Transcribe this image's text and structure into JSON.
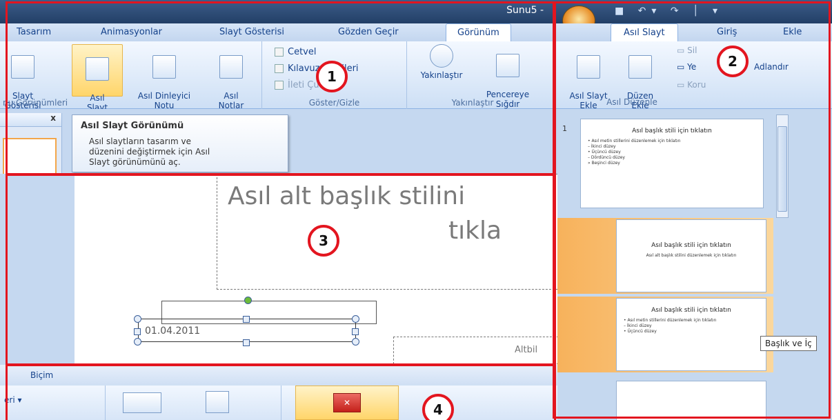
{
  "panel1": {
    "window_title": "Sunu5 -",
    "tabs": [
      "Tasarım",
      "Animasyonlar",
      "Slayt Gösterisi",
      "Gözden Geçir",
      "Görünüm"
    ],
    "btn_slayt_gosterisi": "Slayt\nGösterisi",
    "btn_asil_slayt": "Asıl\nSlayt",
    "btn_asil_dinleyici": "Asıl Dinleyici\nNotu",
    "btn_asil_notlar": "Asıl\nNotlar",
    "group_gorunumleri": "nu Görünümleri",
    "chk_cetvel": "Cetvel",
    "chk_kilavuz": "Kılavuz Çizgileri",
    "chk_ileti": "İleti Çubuğu",
    "group_goster": "Göster/Gizle",
    "btn_yakinlastir": "Yakınlaştır",
    "btn_pencereye": "Pencereye\nSığdır",
    "group_yakinlastir": "Yakınlaştır",
    "close_x": "x",
    "tooltip_title": "Asıl Slayt Görünümü",
    "tooltip_body": "Asıl slaytların tasarım ve\ndüzenini değiştirmek için Asıl\nSlayt görünümünü aç.",
    "circle": "1"
  },
  "panel2": {
    "tabs": [
      "Asıl Slayt",
      "Giriş",
      "Ekle"
    ],
    "btn_asil_slayt_ekle": "Asıl Slayt\nEkle",
    "btn_duzen_ekle": "Düzen\nEkle",
    "small_sil": "Sil",
    "small_yeniden": "Ye",
    "small_adlandir": "Adlandır",
    "small_koru": "Koru",
    "group_label": "Asıl Düzenle",
    "slide_number": "1",
    "thumb1_title": "Asıl başlık stili için tıklatın",
    "thumb1_text": "• Asıl metin stillerini düzenlemek için tıklatın\n  – İkinci düzey\n     • Üçüncü düzey\n        – Dördüncü düzey\n           » Beşinci düzey",
    "thumb2_title": "Asıl başlık stili için tıklatın",
    "thumb2_text": "Asıl alt başlık stilini düzenlemek için tıklatın",
    "thumb3_title": "Asıl başlık stili için tıklatın",
    "thumb3_text": "• Asıl metin stillerini düzenlemek için tıklatın\n  – İkinci düzey\n     • Üçüncü düzey",
    "hover_tip": "Başlık ve İç",
    "circle": "2"
  },
  "panel3": {
    "subtitle_line1": "Asıl alt başlık stilini",
    "subtitle_line2": "tıkla",
    "date": "01.04.2011",
    "footer": "Altbil",
    "circle": "3"
  },
  "panel4": {
    "tab": "Biçim",
    "left_label": "eri",
    "circle": "4"
  }
}
